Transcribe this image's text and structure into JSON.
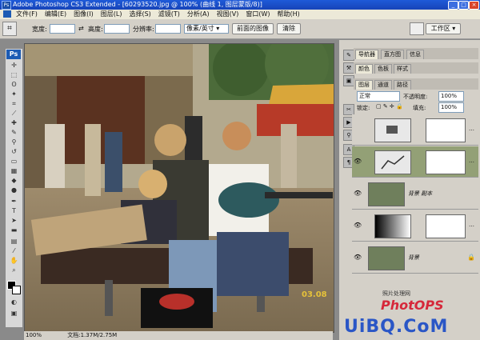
{
  "window": {
    "title": "Adobe Photoshop CS3 Extended - [60293520.jpg @ 100% (曲线 1, 图层蒙版/8)]",
    "minimize": "_",
    "maximize": "□",
    "close": "×"
  },
  "menu": [
    "文件(F)",
    "编辑(E)",
    "图像(I)",
    "图层(L)",
    "选择(S)",
    "滤镜(T)",
    "分析(A)",
    "视图(V)",
    "窗口(W)",
    "帮助(H)"
  ],
  "options": {
    "width_label": "宽度:",
    "height_label": "高度:",
    "resolution_label": "分辨率:",
    "unit_value": "像素/英寸",
    "front_image_btn": "前面的图像",
    "clear_btn": "清除",
    "workspace_label": "工作区 ▾"
  },
  "toolbox": {
    "logo": "Ps"
  },
  "status": {
    "zoom": "100%",
    "doc": "文档:1.37M/2.75M"
  },
  "photo": {
    "date_stamp": "03.08"
  },
  "panels": {
    "top_tabs": [
      "导航器",
      "直方图",
      "信息"
    ],
    "mid_tabs": [
      "颜色",
      "色板",
      "样式"
    ],
    "layer_tabs": [
      "图层",
      "通道",
      "路径"
    ],
    "blend_mode": "正常",
    "opacity_label": "不透明度:",
    "opacity_value": "100%",
    "lock_label": "锁定:",
    "fill_label": "填充:",
    "fill_value": "100%",
    "layers": [
      {
        "name": ""
      },
      {
        "name": ""
      },
      {
        "name": "背景 副本"
      },
      {
        "name": ""
      },
      {
        "name": "背景"
      }
    ]
  },
  "watermark": {
    "site": "照片处理网",
    "brand": "PhotOPS",
    "uibq": "UiBQ.CoM"
  }
}
